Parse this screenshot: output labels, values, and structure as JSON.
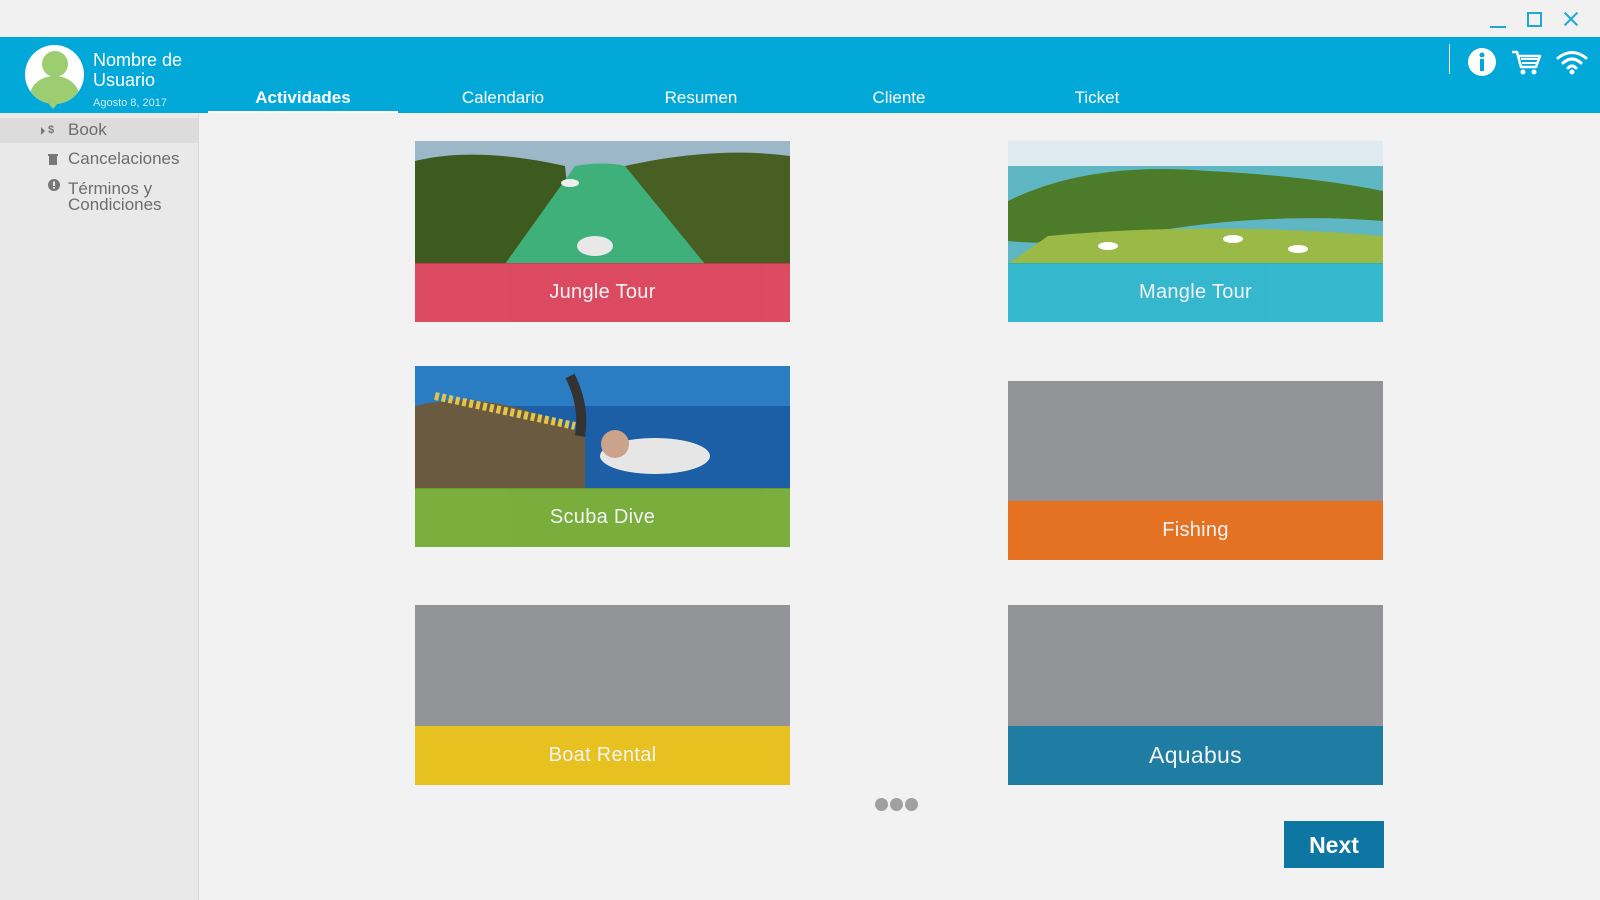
{
  "window": {
    "minimize_icon": "minimize-icon",
    "maximize_icon": "maximize-icon",
    "close_icon": "close-icon"
  },
  "user": {
    "name": "Nombre de Usuario",
    "date": "Agosto 8, 2017"
  },
  "tabs": [
    {
      "label": "Actividades",
      "active": true
    },
    {
      "label": "Calendario",
      "active": false
    },
    {
      "label": "Resumen",
      "active": false
    },
    {
      "label": "Cliente",
      "active": false
    },
    {
      "label": "Ticket",
      "active": false
    }
  ],
  "header_icons": [
    "info-icon",
    "cart-icon",
    "wifi-icon"
  ],
  "sidebar": {
    "items": [
      {
        "label": "Book",
        "icon": "dollar-icon",
        "active": true
      },
      {
        "label": "Cancelaciones",
        "icon": "trash-icon",
        "active": false
      },
      {
        "label": "Términos y Condiciones",
        "icon": "alert-icon",
        "active": false
      }
    ]
  },
  "activities": [
    {
      "label": "Jungle Tour",
      "color": "#d9334f"
    },
    {
      "label": "Mangle Tour",
      "color": "#1bb0c9"
    },
    {
      "label": "Scuba Dive",
      "color": "#6aa523"
    },
    {
      "label": "Fishing",
      "color": "#e47222"
    },
    {
      "label": "Boat Rental",
      "color": "#e6c11f"
    },
    {
      "label": "Aquabus",
      "color": "#1f7da3"
    }
  ],
  "pagination": {
    "pages": 3
  },
  "next_button": {
    "label": "Next"
  },
  "colors": {
    "header": "#02a8d7",
    "placeholder_gray": "#939497",
    "next_button": "#0d76a3"
  }
}
